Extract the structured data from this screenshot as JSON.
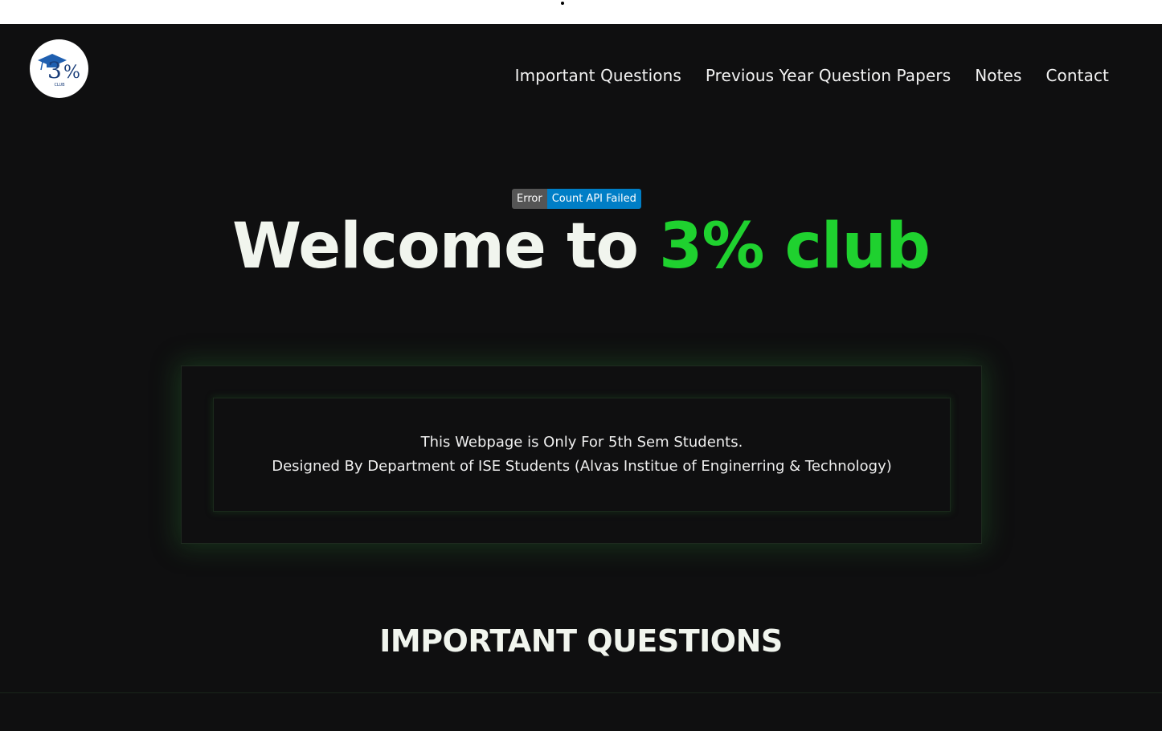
{
  "header": {
    "logo_text": "3%",
    "logo_subtext": "CLUB",
    "nav": [
      {
        "label": "Important Questions"
      },
      {
        "label": "Previous Year Question Papers"
      },
      {
        "label": "Notes"
      },
      {
        "label": "Contact"
      }
    ]
  },
  "badge": {
    "left_label": "Error",
    "right_label": "Count API Failed"
  },
  "hero": {
    "title_prefix": "Welcome to",
    "title_accent": "3% club"
  },
  "info_card": {
    "line1": "This Webpage is Only For 5th Sem Students.",
    "line2": "Designed By Department of ISE Students (Alvas Institue of Enginerring & Technology)"
  },
  "sections": {
    "important_title": "IMPORTANT QUESTIONS"
  },
  "colors": {
    "background": "#0f0f10",
    "accent": "#1fd12f",
    "text": "#f1f5ee",
    "badge_left": "#555555",
    "badge_right": "#007ec6"
  }
}
